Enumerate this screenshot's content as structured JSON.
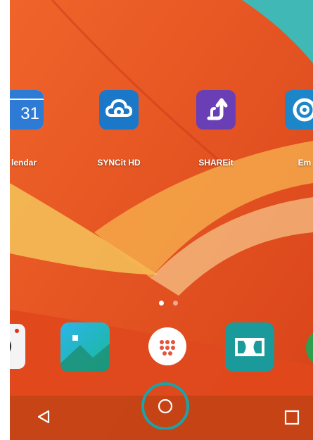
{
  "apps": [
    {
      "label": "lendar",
      "icon": "calendar-icon",
      "day": "31"
    },
    {
      "label": "SYNCit HD",
      "icon": "cloud-sync-icon"
    },
    {
      "label": "SHAREit",
      "icon": "share-arrows-icon"
    },
    {
      "label": "Em",
      "icon": "email-at-icon"
    }
  ],
  "dock": [
    {
      "icon": "camera-icon"
    },
    {
      "icon": "gallery-icon"
    },
    {
      "icon": "app-drawer-icon"
    },
    {
      "icon": "dolby-icon"
    },
    {
      "icon": "phone-icon"
    }
  ],
  "page_indicator": {
    "count": 2,
    "active": 1
  },
  "navigation": {
    "back": "back-icon",
    "home": "home-icon",
    "recents": "recents-icon"
  },
  "colors": {
    "wallpaper": "#e8561d",
    "sync_blue": "#1b78c8",
    "share_purple": "#6a3fb5",
    "home_highlight": "#1aa3a8"
  }
}
